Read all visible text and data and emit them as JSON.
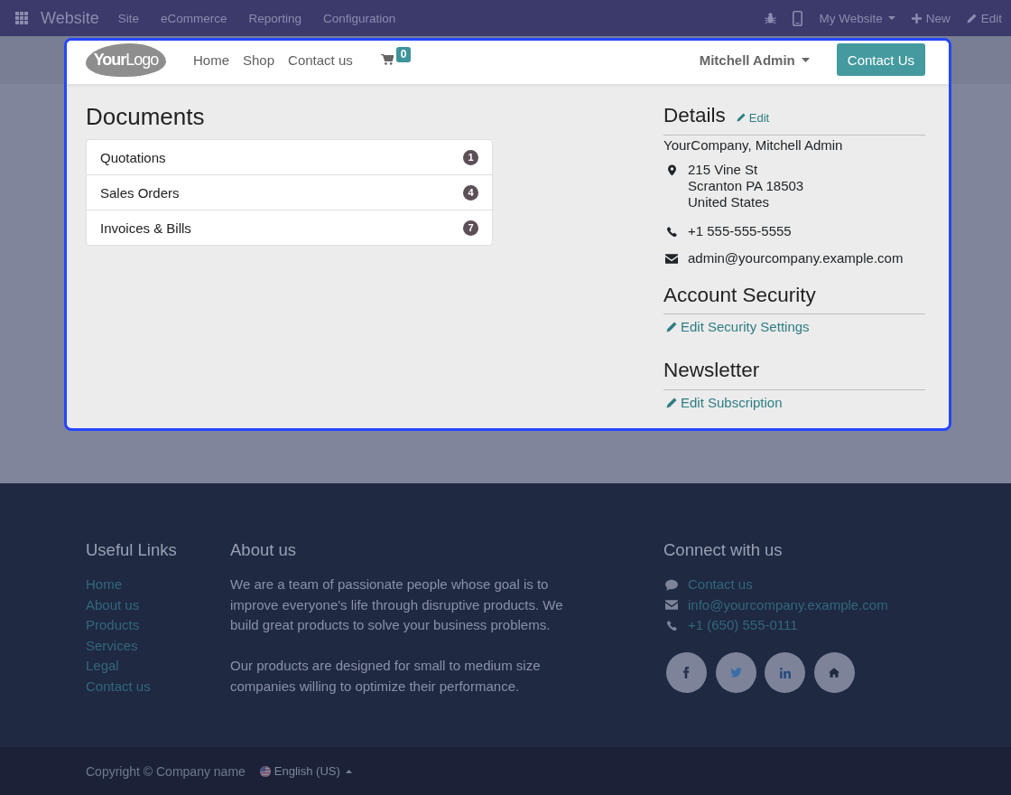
{
  "top_bar": {
    "app_title": "Website",
    "menu": [
      "Site",
      "eCommerce",
      "Reporting",
      "Configuration"
    ],
    "website_selector": "My Website",
    "new_button": "New",
    "edit_button": "Edit"
  },
  "header": {
    "logo": "**Your**Logo",
    "nav": [
      "Home",
      "Shop",
      "Contact us"
    ],
    "cart_count": "0",
    "user": "Mitchell Admin",
    "cta_button": "Contact Us"
  },
  "documents": {
    "title": "Documents",
    "items": [
      {
        "label": "Quotations",
        "count": "1"
      },
      {
        "label": "Sales Orders",
        "count": "4"
      },
      {
        "label": "Invoices & Bills",
        "count": "7"
      }
    ]
  },
  "details": {
    "title": "Details",
    "edit_link": "Edit",
    "name": "YourCompany, Mitchell Admin",
    "address": [
      "215 Vine St",
      "Scranton PA 18503",
      "United States"
    ],
    "phone": "+1 555-555-5555",
    "email": "admin@yourcompany.example.com"
  },
  "account_security": {
    "title": "Account Security",
    "link": "Edit Security Settings"
  },
  "newsletter": {
    "title": "Newsletter",
    "link": "Edit Subscription"
  },
  "footer": {
    "useful_links": {
      "title": "Useful Links",
      "links": [
        "Home",
        "About us",
        "Products",
        "Services",
        "Legal",
        "Contact us"
      ]
    },
    "about": {
      "title": "About us",
      "paragraphs": [
        "We are a team of passionate people whose goal is to improve everyone's life through disruptive products. We build great products to solve your business problems.",
        "Our products are designed for small to medium size companies willing to optimize their performance."
      ]
    },
    "connect": {
      "title": "Connect with us",
      "contact_link": "Contact us",
      "email": "info@yourcompany.example.com",
      "phone": "+1 (650) 555-0111"
    }
  },
  "bottom_bar": {
    "copyright": "Copyright © Company name",
    "language": "English (US)"
  }
}
